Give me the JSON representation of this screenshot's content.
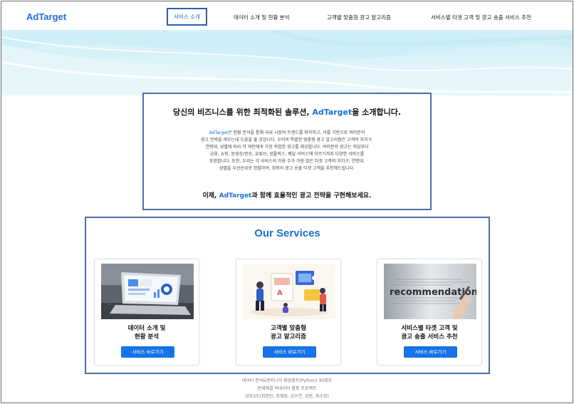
{
  "nav": {
    "logo": "AdTarget",
    "links": [
      {
        "label": "서비스 소개",
        "active": true
      },
      {
        "label": "데이터 소개 및 현황 분석",
        "active": false
      },
      {
        "label": "고객별 맞춤형 광고 알고리즘",
        "active": false
      },
      {
        "label": "서비스별 타겟 고객 및 광고 송출 서비스 추천",
        "active": false
      }
    ]
  },
  "intro": {
    "title_pre": "당신의 비즈니스를 위한 최적화된 솔루션,",
    "title_brand": "AdTarget",
    "title_post": "을 소개합니다.",
    "body_brand": "AdTarget",
    "body_lines": [
      "은 현황 분석을 통해 국내 시장의 트렌드를 파악하고, 이를 기반으로 여러분의",
      "광고 전략을 세우는데 도움을 줄 것입니다. 우리의 특별한 맞춤형 광고 알고리즘은 고객의 자치구,",
      "연령대, 성별에 따라 각 개인에게 가장 적합한 광고를 제공합니다. 여러분의 광고는 게임부터",
      "금융, 쇼핑, 동영상/방송, 유튜브, 넷플릭스, 배달 서비스에 이르기까지 다양한 서비스를",
      "포함합니다. 또한, 우리는 각 서비스의 이용 수가 가장 많은 타겟 고객의 자치구, 연령대,",
      "성별을 우선순위로 정렬하여, 최적의 광고 송출 타겟 고객을 추천해드립니다."
    ],
    "cta_pre": "이제,",
    "cta_brand": "AdTarget",
    "cta_post": "과 함께 효율적인 광고 전략을 구현해보세요."
  },
  "services": {
    "heading": "Our Services",
    "cards": [
      {
        "title_line1": "데이터 소개 및",
        "title_line2": "현황 분석",
        "button": "서비스 바로가기",
        "image_icon": "laptop-dashboard-image"
      },
      {
        "title_line1": "고객별 맞춤형",
        "title_line2": "광고 알고리즘",
        "button": "서비스 바로가기",
        "image_icon": "people-marketing-illustration"
      },
      {
        "title_line1": "서비스별 타겟 고객 및",
        "title_line2": "광고 송출 서비스 추천",
        "button": "서비스 바로가기",
        "image_icon": "recommendation-word-image"
      }
    ],
    "recommendation_text": "recommendation"
  },
  "footer": {
    "lines": [
      "데이터 분석&엔지니어 취업캠프(Python) 30회차",
      "문제해결 빅데이터 활용 프로젝트",
      "상부3조(최현민, 정혜원, 김수연, 강현, 최수정)"
    ]
  },
  "colors": {
    "accent": "#1a6fd1",
    "button": "#1573e6",
    "highlight_border": "#4a6ea9"
  }
}
